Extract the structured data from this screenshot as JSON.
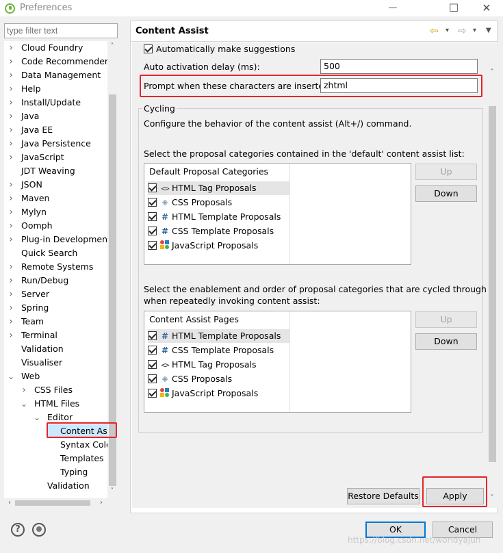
{
  "window": {
    "title": "Preferences",
    "minimize": "—",
    "maximize": "☐",
    "close": "✕"
  },
  "filter": {
    "placeholder": "type filter text"
  },
  "tree": {
    "items": [
      {
        "label": "Cloud Foundry",
        "arrow": "›"
      },
      {
        "label": "Code Recommenders",
        "arrow": "›"
      },
      {
        "label": "Data Management",
        "arrow": "›"
      },
      {
        "label": "Help",
        "arrow": "›"
      },
      {
        "label": "Install/Update",
        "arrow": "›"
      },
      {
        "label": "Java",
        "arrow": "›"
      },
      {
        "label": "Java EE",
        "arrow": "›"
      },
      {
        "label": "Java Persistence",
        "arrow": "›"
      },
      {
        "label": "JavaScript",
        "arrow": "›"
      },
      {
        "label": "JDT Weaving",
        "arrow": ""
      },
      {
        "label": "JSON",
        "arrow": "›"
      },
      {
        "label": "Maven",
        "arrow": "›"
      },
      {
        "label": "Mylyn",
        "arrow": "›"
      },
      {
        "label": "Oomph",
        "arrow": "›"
      },
      {
        "label": "Plug-in Development",
        "arrow": "›"
      },
      {
        "label": "Quick Search",
        "arrow": ""
      },
      {
        "label": "Remote Systems",
        "arrow": "›"
      },
      {
        "label": "Run/Debug",
        "arrow": "›"
      },
      {
        "label": "Server",
        "arrow": "›"
      },
      {
        "label": "Spring",
        "arrow": "›"
      },
      {
        "label": "Team",
        "arrow": "›"
      },
      {
        "label": "Terminal",
        "arrow": "›"
      },
      {
        "label": "Validation",
        "arrow": ""
      },
      {
        "label": "Visualiser",
        "arrow": ""
      },
      {
        "label": "Web",
        "arrow": "⌄"
      },
      {
        "label": "CSS Files",
        "arrow": "›"
      },
      {
        "label": "HTML Files",
        "arrow": "⌄"
      },
      {
        "label": "Editor",
        "arrow": "⌄"
      },
      {
        "label": "Content Ass",
        "arrow": ""
      },
      {
        "label": "Syntax Colo",
        "arrow": ""
      },
      {
        "label": "Templates",
        "arrow": ""
      },
      {
        "label": "Typing",
        "arrow": ""
      },
      {
        "label": "Validation",
        "arrow": ""
      }
    ],
    "scroll_up": "˄",
    "scroll_down": "˅",
    "scroll_left": "‹",
    "scroll_right": "›"
  },
  "page": {
    "title": "Content Assist",
    "nav_back": "⇦",
    "nav_forward": "⇨",
    "dropdown": "▾",
    "menu": "▼"
  },
  "content": {
    "auto_suggest_label": "Automatically make suggestions",
    "delay_label": "Auto activation delay (ms):",
    "delay_value": "500",
    "prompt_label": "Prompt when these characters are inserted:",
    "prompt_value": "zhtml",
    "cycling_title": "Cycling",
    "cycling_desc": "Configure the behavior of the content assist (Alt+/) command.",
    "default_list_desc": "Select the proposal categories contained in the 'default' content assist list:",
    "default_header": "Default Proposal Categories",
    "default_items": [
      {
        "label": "HTML Tag Proposals",
        "icon": "tag-icon"
      },
      {
        "label": "CSS Proposals",
        "icon": "css-icon"
      },
      {
        "label": "HTML Template Proposals",
        "icon": "template-icon"
      },
      {
        "label": "CSS Template Proposals",
        "icon": "template-icon"
      },
      {
        "label": "JavaScript Proposals",
        "icon": "js-icon"
      }
    ],
    "up_label": "Up",
    "down_label": "Down",
    "cycle_desc_1": "Select the enablement and order of proposal categories that are cycled through",
    "cycle_desc_2": "when repeatedly invoking content assist:",
    "cycle_header": "Content Assist Pages",
    "cycle_items": [
      {
        "label": "HTML Template Proposals",
        "icon": "template-icon"
      },
      {
        "label": "CSS Template Proposals",
        "icon": "template-icon"
      },
      {
        "label": "HTML Tag Proposals",
        "icon": "tag-icon"
      },
      {
        "label": "CSS Proposals",
        "icon": "css-icon"
      },
      {
        "label": "JavaScript Proposals",
        "icon": "js-icon"
      }
    ],
    "restore_label": "Restore Defaults",
    "apply_label": "Apply"
  },
  "footer": {
    "ok_label": "OK",
    "cancel_label": "Cancel",
    "help_glyph": "?",
    "watermark": "https://blog.csdn.net/worldyajun"
  },
  "colors": {
    "highlight": "#e5242a",
    "focus": "#0078d7"
  }
}
